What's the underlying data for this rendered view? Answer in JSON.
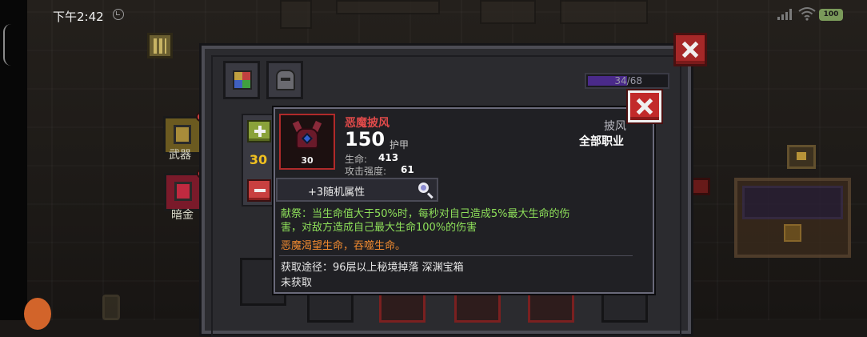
{
  "status_bar": {
    "time": "下午2:42",
    "battery": "100"
  },
  "side_menu": {
    "weapon_label": "武器",
    "secret_label": "暗金"
  },
  "inventory": {
    "capacity": "34/68",
    "capacity_fraction": 0.5
  },
  "stepper": {
    "count": "30"
  },
  "item": {
    "name": "恶魔披风",
    "level": "30",
    "armor_value": "150",
    "armor_label": "护甲",
    "stats": [
      {
        "label": "生命:",
        "value": "413"
      },
      {
        "label": "攻击强度:",
        "value": "61"
      }
    ],
    "type": "披风",
    "class": "全部职业",
    "random_attributes": "+3随机属性",
    "effect_line1": "献祭：当生命值大于50%时，每秒对自己造成5%最大生命的伤",
    "effect_line2": "害，对敌方造成自己最大生命100%的伤害",
    "curse": "恶魔渴望生命，吞噬生命。",
    "source": "获取途径：96层以上秘境掉落 深渊宝箱",
    "obtain_status": "未获取"
  },
  "colors": {
    "item_name": "#e04a4a",
    "effect": "#8ee05a",
    "curse": "#f08a30",
    "stepper_count": "#f0c020",
    "close_button": "#c22a2a"
  }
}
